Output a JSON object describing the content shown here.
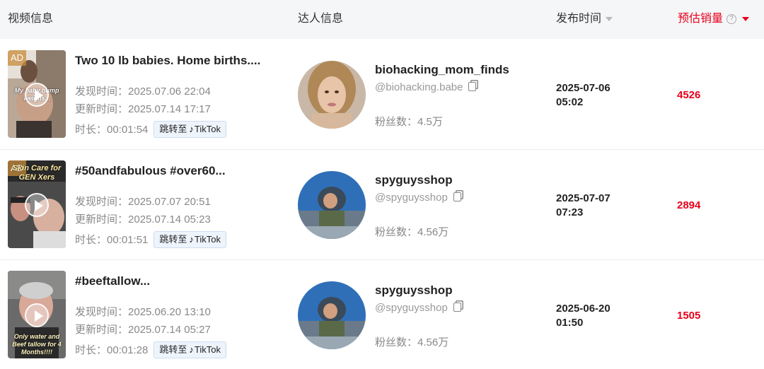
{
  "header": {
    "video_info": "视频信息",
    "creator_info": "达人信息",
    "publish_time": "发布时间",
    "estimated_sales": "预估销量",
    "help": "?"
  },
  "labels": {
    "found": "发现时间：",
    "updated": "更新时间：",
    "duration": "时长：",
    "jump_to": "跳转至",
    "tiktok": "TikTok",
    "fans": "粉丝数：",
    "ad": "AD"
  },
  "rows": [
    {
      "title": "Two 10 lb babies. Home births....",
      "found": "2025.07.06 22:04",
      "updated": "2025.07.14 17:17",
      "duration": "00:01:54",
      "ad": true,
      "thumb_caption": "My baby bump weighs...",
      "creator_name": "biohacking_mom_finds",
      "creator_handle": "@biohacking.babe",
      "fans": "4.5万",
      "publish_date": "2025-07-06",
      "publish_clock": "05:02",
      "sales": "4526"
    },
    {
      "title": "#50andfabulous #over60...",
      "found": "2025.07.07 20:51",
      "updated": "2025.07.14 05:23",
      "duration": "00:01:51",
      "ad": true,
      "thumb_caption": "Skin Care for GEN Xers",
      "creator_name": "spyguysshop",
      "creator_handle": "@spyguysshop",
      "fans": "4.56万",
      "publish_date": "2025-07-07",
      "publish_clock": "07:23",
      "sales": "2894"
    },
    {
      "title": "#beeftallow...",
      "found": "2025.06.20 13:10",
      "updated": "2025.07.14 05:27",
      "duration": "00:01:28",
      "ad": false,
      "thumb_caption": "Only water and Beef tallow for 4 Months!!!!",
      "creator_name": "spyguysshop",
      "creator_handle": "@spyguysshop",
      "fans": "4.56万",
      "publish_date": "2025-06-20",
      "publish_clock": "01:50",
      "sales": "1505"
    }
  ],
  "colors": {
    "accent_red": "#e8001c",
    "header_bg": "#f5f6f8",
    "tiktok_button_bg": "#eef4fc"
  }
}
